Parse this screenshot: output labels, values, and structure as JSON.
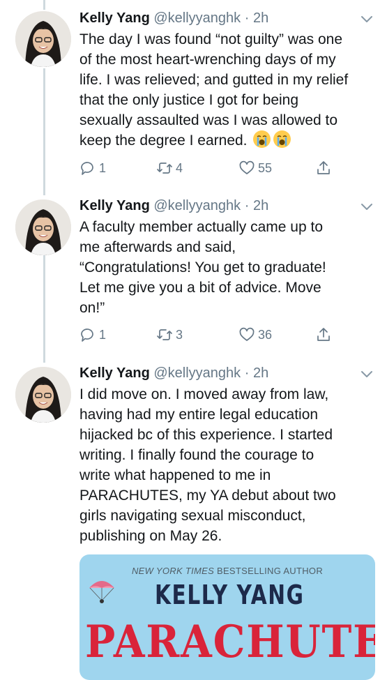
{
  "tweets": [
    {
      "name": "Kelly Yang",
      "handle": "@kellyyanghk",
      "separator": "·",
      "time": "2h",
      "lines": [
        "The day I was found “not guilty” was one",
        "of the most heart-wrenching days of my",
        "life. I was relieved; and gutted in my relief",
        "that the only justice I got for being",
        "sexually assaulted was I was allowed to",
        "keep the degree I earned."
      ],
      "emojis": [
        "loudly-crying-face",
        "loudly-crying-face"
      ],
      "replies": "1",
      "retweets": "4",
      "likes": "55"
    },
    {
      "name": "Kelly Yang",
      "handle": "@kellyyanghk",
      "separator": "·",
      "time": "2h",
      "lines": [
        "A faculty member actually came up to",
        "me afterwards and said,",
        "“Congratulations! You get to graduate!",
        "Let me give you a bit of advice. Move",
        "on!”"
      ],
      "replies": "1",
      "retweets": "3",
      "likes": "36"
    },
    {
      "name": "Kelly Yang",
      "handle": "@kellyyanghk",
      "separator": "·",
      "time": "2h",
      "lines": [
        "I did move on. I moved away from law,",
        "having had my entire legal education",
        "hijacked bc of this experience. I started",
        "writing. I finally found the courage to",
        "write what happened to me in",
        "PARACHUTES, my YA debut about two",
        "girls navigating sexual misconduct,",
        "publishing on May 26."
      ]
    }
  ],
  "book": {
    "tag_italic": "NEW YORK TIMES",
    "tag_rest": " BESTSELLING AUTHOR",
    "author": "KELLY YANG",
    "title": "PARACHUTES"
  },
  "colors": {
    "text": "#14171a",
    "secondary": "#657786",
    "thread_line": "#cfd9de",
    "book_bg": "#9fd5ee",
    "book_title": "#d9243a"
  },
  "icons": [
    "reply-icon",
    "retweet-icon",
    "like-icon",
    "share-icon",
    "chevron-down-icon"
  ]
}
